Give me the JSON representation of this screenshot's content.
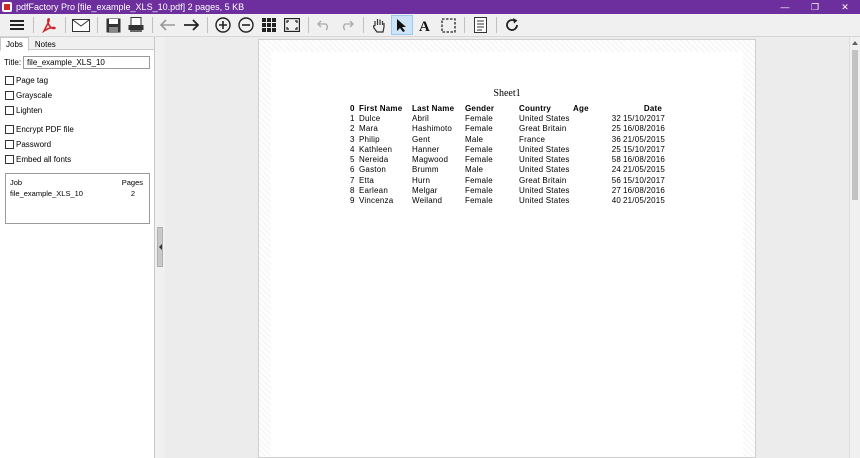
{
  "window": {
    "title": "pdfFactory Pro [file_example_XLS_10.pdf] 2 pages, 5 KB",
    "minimize": "—",
    "restore": "❐",
    "close": "✕"
  },
  "toolbar": {
    "items": [
      "menu-icon",
      "pdf-icon",
      "email-icon",
      "save-icon",
      "print-icon",
      "back-arrow-icon",
      "forward-arrow-icon",
      "zoom-in-icon",
      "zoom-out-icon",
      "thumbnails-icon",
      "fit-page-icon",
      "undo-icon",
      "redo-icon",
      "hand-tool-icon",
      "select-arrow-icon",
      "text-tool-icon",
      "marquee-select-icon",
      "page-settings-icon",
      "refresh-icon"
    ]
  },
  "left_panel": {
    "tabs": [
      "Jobs",
      "Notes"
    ],
    "title_label": "Title:",
    "title_value": "file_example_XLS_10",
    "checkboxes": [
      "Page tag",
      "Grayscale",
      "Lighten",
      "Encrypt PDF file",
      "Password",
      "Embed all fonts"
    ],
    "jobs_header": {
      "job": "Job",
      "pages": "Pages"
    },
    "jobs": [
      {
        "name": "file_example_XLS_10",
        "pages": "2"
      }
    ]
  },
  "document": {
    "sheet_title": "Sheet1",
    "columns": [
      "0",
      "First Name",
      "Last Name",
      "Gender",
      "Country",
      "Age",
      "Date"
    ],
    "rows": [
      [
        "1",
        "Dulce",
        "Abril",
        "Female",
        "United States",
        "32",
        "15/10/2017"
      ],
      [
        "2",
        "Mara",
        "Hashimoto",
        "Female",
        "Great Britain",
        "25",
        "16/08/2016"
      ],
      [
        "3",
        "Philip",
        "Gent",
        "Male",
        "France",
        "36",
        "21/05/2015"
      ],
      [
        "4",
        "Kathleen",
        "Hanner",
        "Female",
        "United States",
        "25",
        "15/10/2017"
      ],
      [
        "5",
        "Nereida",
        "Magwood",
        "Female",
        "United States",
        "58",
        "16/08/2016"
      ],
      [
        "6",
        "Gaston",
        "Brumm",
        "Male",
        "United States",
        "24",
        "21/05/2015"
      ],
      [
        "7",
        "Etta",
        "Hurn",
        "Female",
        "Great Britain",
        "56",
        "15/10/2017"
      ],
      [
        "8",
        "Earlean",
        "Melgar",
        "Female",
        "United States",
        "27",
        "16/08/2016"
      ],
      [
        "9",
        "Vincenza",
        "Weiland",
        "Female",
        "United States",
        "40",
        "21/05/2015"
      ]
    ]
  },
  "colors": {
    "titlebar": "#6d2f9e",
    "pdf_red": "#d0242b"
  }
}
